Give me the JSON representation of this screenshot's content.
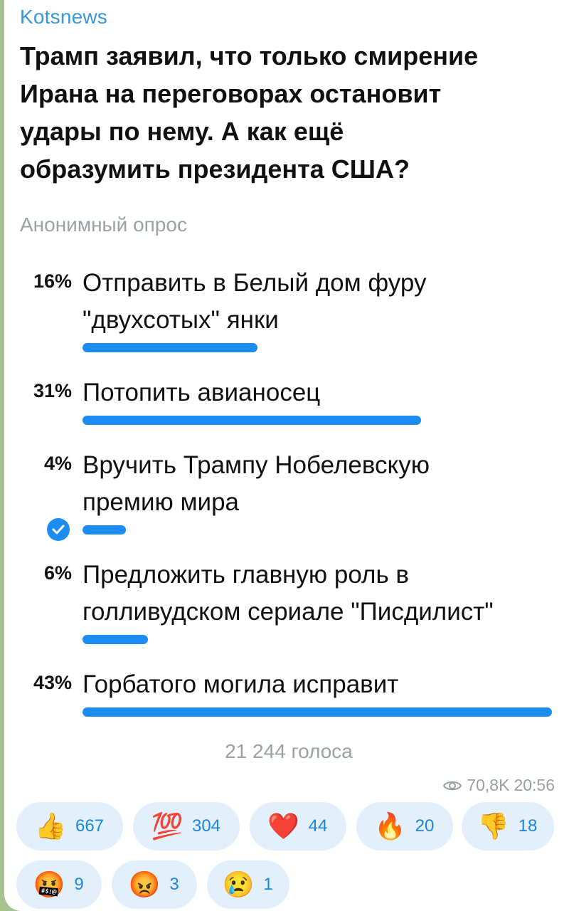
{
  "post": {
    "channel_name": "Kotsnews",
    "question": "Трамп заявил, что только смирение\nИрана на переговорах остановит\nудары по нему. А как ещё\nобразумить президента США?",
    "poll_type": "Анонимный опрос",
    "options": [
      {
        "percent": "16%",
        "text": "Отправить в Белый дом фуру\n\"двухсотых\" янки",
        "share": 0.16,
        "selected": false
      },
      {
        "percent": "31%",
        "text": "Потопить авианосец",
        "share": 0.31,
        "selected": false
      },
      {
        "percent": "4%",
        "text": "Вручить  Трампу Нобелевскую\nпремию мира",
        "share": 0.04,
        "selected": true
      },
      {
        "percent": "6%",
        "text": "Предложить главную роль в\nголливудском сериале \"Писдилист\"",
        "share": 0.06,
        "selected": false
      },
      {
        "percent": "43%",
        "text": "Горбатого могила исправит",
        "share": 0.43,
        "selected": false
      }
    ],
    "votes": "21 244 голоса",
    "views": "70,8K",
    "time": "20:56"
  },
  "reactions": [
    {
      "emoji": "👍",
      "icon": "thumbs-up-icon",
      "count": "667"
    },
    {
      "emoji": "💯",
      "icon": "hundred-points-icon",
      "count": "304"
    },
    {
      "emoji": "❤️",
      "icon": "red-heart-icon",
      "count": "44"
    },
    {
      "emoji": "🔥",
      "icon": "fire-icon",
      "count": "20"
    },
    {
      "emoji": "👎",
      "icon": "thumbs-down-icon",
      "count": "18"
    },
    {
      "emoji": "🤬",
      "icon": "cursing-face-icon",
      "count": "9"
    },
    {
      "emoji": "😡",
      "icon": "angry-face-icon",
      "count": "3"
    },
    {
      "emoji": "😢",
      "icon": "crying-face-icon",
      "count": "1"
    }
  ],
  "colors": {
    "accent": "#1c8cf0",
    "channel": "#3a96d6",
    "muted": "#9aa0a6",
    "reaction_bg": "#e3f0fb",
    "chat_bg": "#a6c48f"
  }
}
